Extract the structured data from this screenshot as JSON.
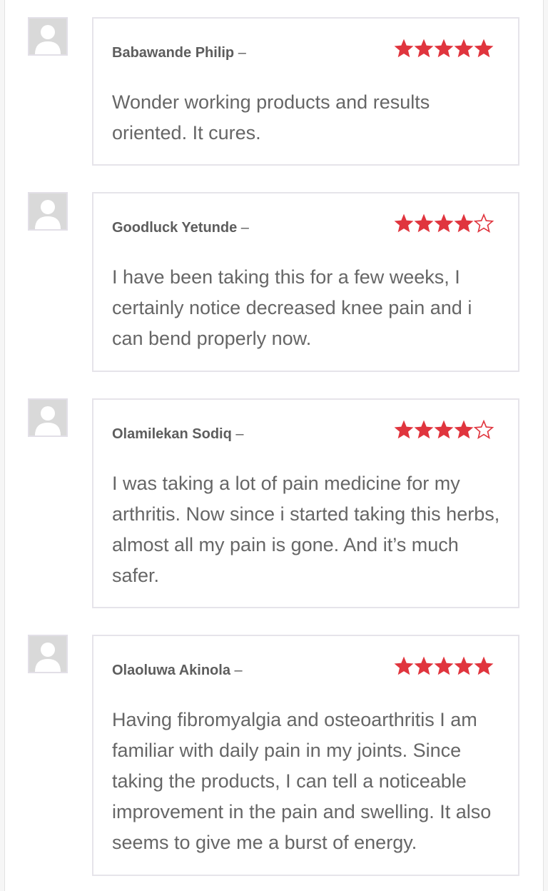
{
  "colors": {
    "star": "#e0353e",
    "text": "#666666",
    "author": "#5d5d5d",
    "border": "#e6e4ea"
  },
  "reviews": [
    {
      "author": "Babawande Philip",
      "separator": "–",
      "rating": 5,
      "max_rating": 5,
      "text": "Wonder working products and results oriented. It cures.",
      "avatar_icon": "default-user-icon"
    },
    {
      "author": "Goodluck Yetunde",
      "separator": "–",
      "rating": 4,
      "max_rating": 5,
      "text": "I have been taking this for a few weeks, I certainly notice decreased knee pain and i can bend properly now.",
      "avatar_icon": "default-user-icon"
    },
    {
      "author": "Olamilekan Sodiq",
      "separator": "–",
      "rating": 4,
      "max_rating": 5,
      "text": "I was taking a lot of pain medicine for my arthritis. Now since i started taking this herbs, almost all my pain is gone. And it’s much safer.",
      "avatar_icon": "default-user-icon"
    },
    {
      "author": "Olaoluwa Akinola",
      "separator": "–",
      "rating": 5,
      "max_rating": 5,
      "text": "Having fibromyalgia and osteoarthritis I am familiar with daily pain in my joints. Since taking the products, I can tell a noticeable improvement in the pain and swelling. It also seems to give me a burst of energy.",
      "avatar_icon": "default-user-icon"
    }
  ]
}
